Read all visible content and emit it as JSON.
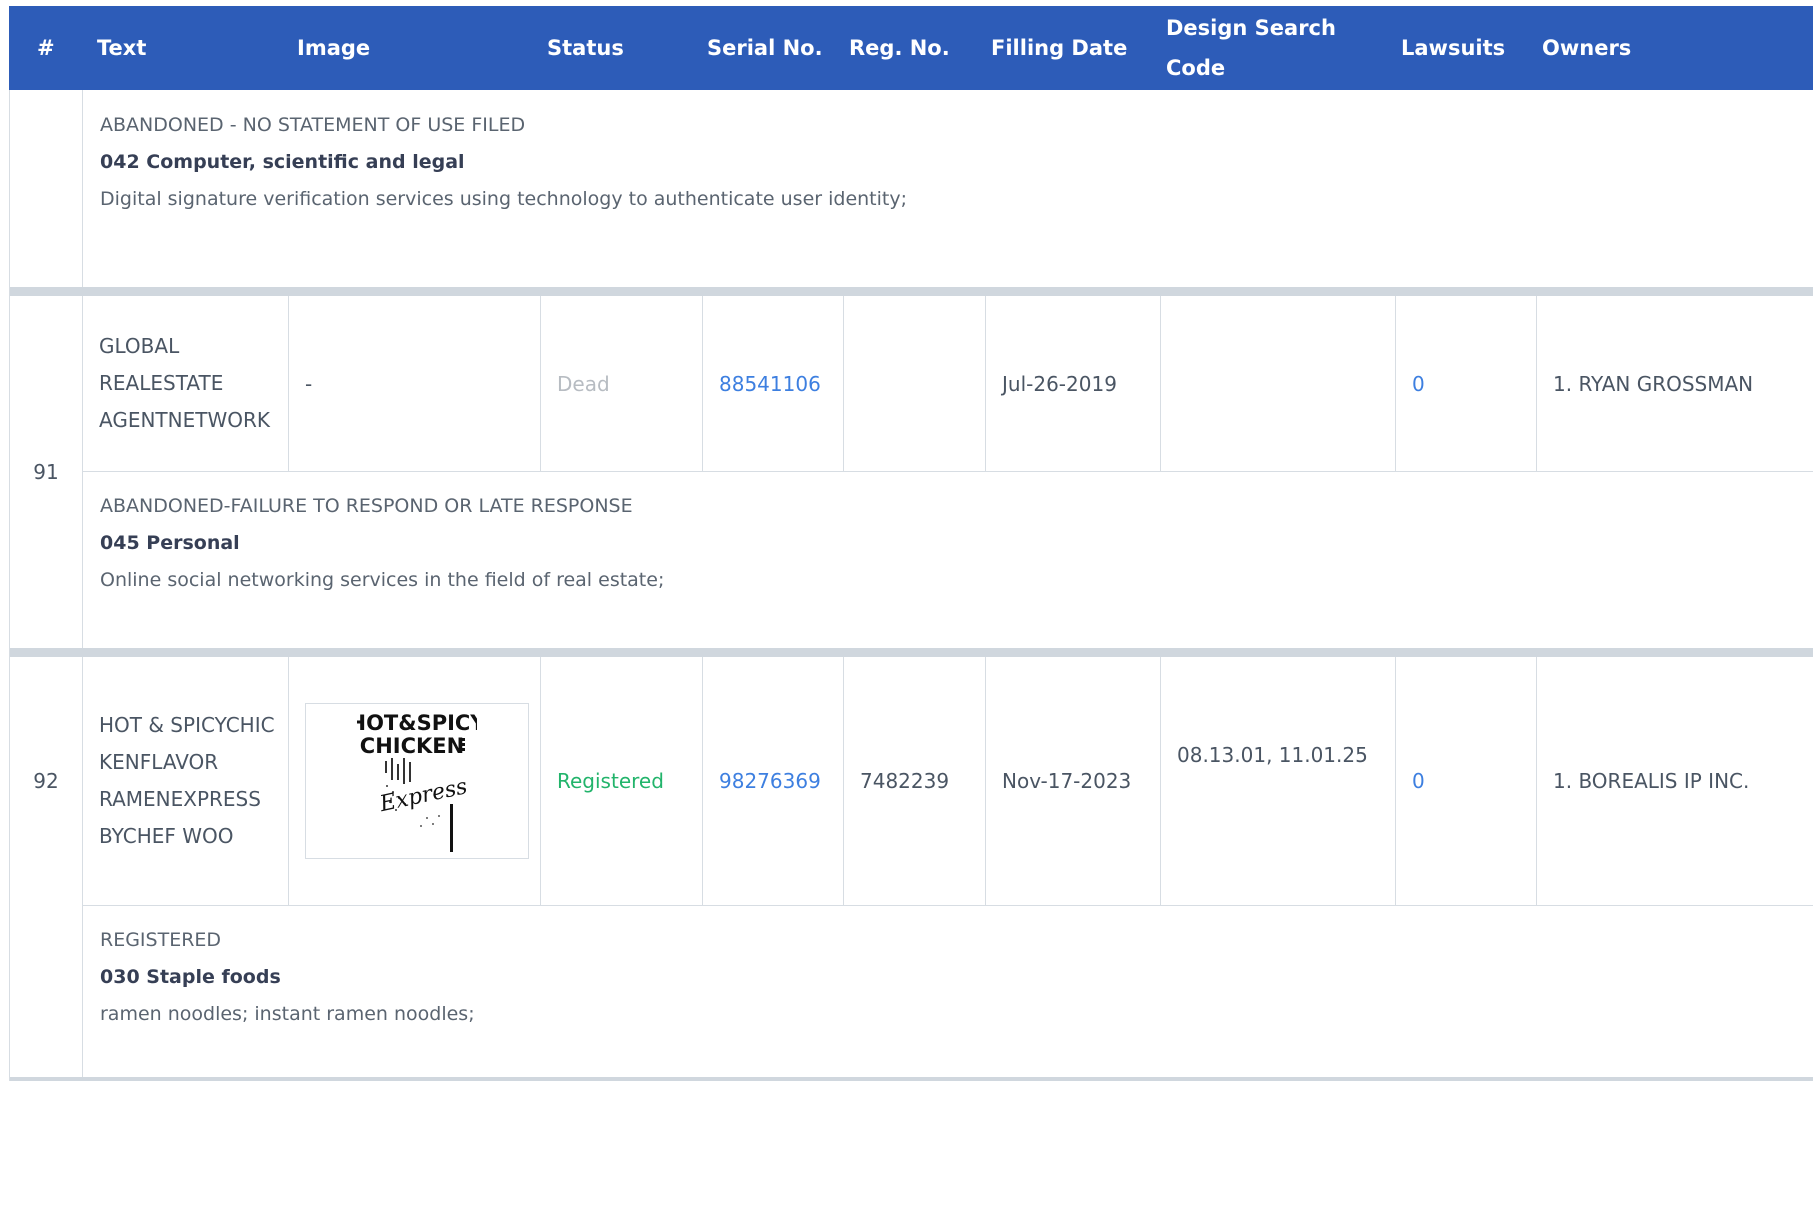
{
  "headers": {
    "num": "#",
    "text": "Text",
    "image": "Image",
    "status": "Status",
    "serial": "Serial No.",
    "reg": "Reg. No.",
    "filing": "Filling Date",
    "design_line1": "Design Search",
    "design_line2": "Code",
    "lawsuits": "Lawsuits",
    "owners": "Owners"
  },
  "prev_detail": {
    "status": "ABANDONED - NO STATEMENT OF USE FILED",
    "class": "042 Computer, scientific and legal",
    "description": "Digital signature verification services using technology to authenticate user identity;"
  },
  "rows": [
    {
      "num": "91",
      "text_lines": [
        "GLOBAL",
        "REALESTATE",
        "AGENTNETWORK"
      ],
      "image": "-",
      "status": "Dead",
      "serial": "88541106",
      "reg": "",
      "filing": "Jul-26-2019",
      "design": "",
      "lawsuits": "0",
      "owners": "1. RYAN GROSSMAN",
      "detail": {
        "status": "ABANDONED-FAILURE TO RESPOND OR LATE RESPONSE",
        "class": "045 Personal",
        "description": "Online social networking services in the field of real estate;"
      }
    },
    {
      "num": "92",
      "text_lines": [
        "HOT & SPICYCHIC",
        "KENFLAVOR",
        "RAMENEXPRESS",
        "BYCHEF WOO"
      ],
      "image": "HOT&SPICY CHICKEN Express",
      "status": "Registered",
      "serial": "98276369",
      "reg": "7482239",
      "filing": "Nov-17-2023",
      "design": "08.13.01, 11.01.25",
      "lawsuits": "0",
      "owners": "1. BOREALIS IP INC.",
      "detail": {
        "status": "REGISTERED",
        "class": "030 Staple foods",
        "description": "ramen noodles; instant ramen noodles;"
      }
    }
  ],
  "logo": {
    "line1": "HOT&SPICY",
    "line2": "CHICKEN",
    "line3": "Express"
  },
  "colors": {
    "header_bg": "#2d5cb8",
    "link": "#3d7fe0",
    "registered": "#22b46b",
    "dead": "#b7bcc2",
    "separator": "#d0d7de"
  }
}
